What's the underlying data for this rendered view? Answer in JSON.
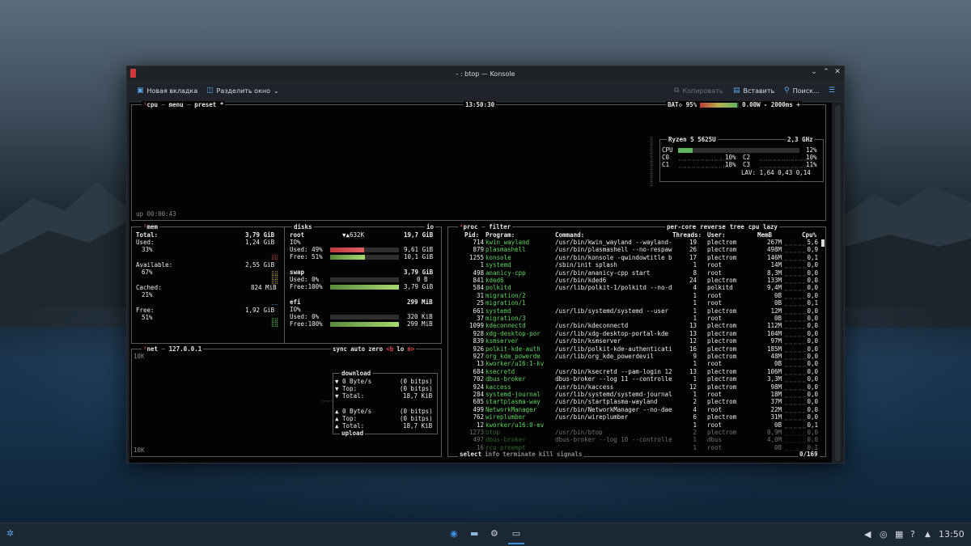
{
  "window": {
    "title": "- : btop — Konsole",
    "controls": [
      "⌄",
      "⌃",
      "✕"
    ]
  },
  "toolbar": {
    "new_tab": "Новая вкладка",
    "split": "Разделить окно",
    "copy": "Копировать",
    "paste": "Вставить",
    "search": "Поиск...",
    "new_tab_icon": "tab-icon",
    "split_icon": "split-view-icon",
    "copy_icon": "copy-icon",
    "paste_icon": "clipboard-icon",
    "search_icon": "search-icon",
    "menu_icon": "hamburger-icon"
  },
  "cpu": {
    "menu_cpu": "cpu",
    "menu_menu": "menu",
    "menu_preset": "preset",
    "menu_star": "*",
    "clock": "13:50:30",
    "battery": "BAT◇ 95%",
    "battery_level": 0.95,
    "power": "0.00W",
    "interval": "- 2000ms +",
    "uptime": "up 00:00:43",
    "model": "Ryzen 5 5625U",
    "freq": "2,3 GHz",
    "cpu_label": "CPU",
    "cpu_total": "12%",
    "cpu_total_level": 0.12,
    "cores": [
      {
        "name": "C0",
        "pct": "10%"
      },
      {
        "name": "C1",
        "pct": "18%"
      },
      {
        "name": "C2",
        "pct": "10%"
      },
      {
        "name": "C3",
        "pct": "11%"
      }
    ],
    "lav": "LAV: 1,64 0,43 0,14"
  },
  "mem": {
    "title": "mem",
    "total_label": "Total:",
    "total": "3,79 GiB",
    "used_label": "Used:",
    "used": "1,24 GiB",
    "used_pct": "33%",
    "avail_label": "Available:",
    "avail": "2,55 GiB",
    "avail_pct": "67%",
    "cached_label": "Cached:",
    "cached": "824 MiB",
    "cached_pct": "21%",
    "free_label": "Free:",
    "free": "1,92 GiB",
    "free_pct": "51%"
  },
  "disks": {
    "title": "disks",
    "io_label": "io",
    "items": [
      {
        "name": "root",
        "io_value": "▼▲632K",
        "size": "19,7 GiB",
        "io": "IO%",
        "used_label": "Used: 49%",
        "used": "9,61 GiB",
        "used_level": 0.49,
        "free_label": "Free: 51%",
        "free": "10,1 GiB",
        "free_level": 0.51
      },
      {
        "name": "swap",
        "size": "3,79 GiB",
        "used_label": "Used:  0%",
        "used": "0 B",
        "used_level": 0,
        "free_label": "Free:100%",
        "free": "3,79 GiB",
        "free_level": 1
      },
      {
        "name": "efi",
        "size": "299 MiB",
        "io": "IO%",
        "used_label": "Used:  0%",
        "used": "320 KiB",
        "used_level": 0,
        "free_label": "Free:100%",
        "free": "299 MiB",
        "free_level": 1
      }
    ]
  },
  "net": {
    "title": "net",
    "iface": "127.0.0.1",
    "opts": [
      "sync",
      "auto",
      "zero",
      "<b",
      "lo",
      "n>"
    ],
    "scale_top": "10K",
    "scale_bottom": "10K",
    "download_title": "download",
    "upload_title": "upload",
    "download": [
      {
        "label": "▼ 0 Byte/s",
        "value": "(0 bitps)"
      },
      {
        "label": "▼ Top:",
        "value": "(0 bitps)"
      },
      {
        "label": "▼ Total:",
        "value": "18,7 KiB"
      }
    ],
    "upload": [
      {
        "label": "▲ 0 Byte/s",
        "value": "(0 bitps)"
      },
      {
        "label": "▲ Top:",
        "value": "(0 bitps)"
      },
      {
        "label": "▲ Total:",
        "value": "18,7 KiB"
      }
    ]
  },
  "proc": {
    "title": "proc",
    "filter": "filter",
    "opts": [
      "per-core",
      "reverse",
      "tree",
      "cpu lazy"
    ],
    "headers": {
      "pid": "Pid:",
      "program": "Program:",
      "command": "Command:",
      "threads": "Threads:",
      "user": "User:",
      "mem": "MemB",
      "cpu": "Cpu%"
    },
    "rows": [
      [
        "714",
        "kwin_wayland",
        "/usr/bin/kwin_wayland --wayland-",
        "19",
        "plectrom",
        "267M",
        "5,6"
      ],
      [
        "879",
        "plasmashell",
        "/usr/bin/plasmashell --no-respaw",
        "26",
        "plectrom",
        "498M",
        "0,9"
      ],
      [
        "1255",
        "konsole",
        "/usr/bin/konsole -qwindowtitle b",
        "17",
        "plectrom",
        "146M",
        "0,1"
      ],
      [
        "1",
        "systemd",
        "/sbin/init splash",
        "1",
        "root",
        "14M",
        "0,0"
      ],
      [
        "498",
        "ananicy-cpp",
        "/usr/bin/ananicy-cpp start",
        "8",
        "root",
        "8,3M",
        "0,0"
      ],
      [
        "841",
        "kded6",
        "/usr/bin/kded6",
        "24",
        "plectrom",
        "133M",
        "0,0"
      ],
      [
        "584",
        "polkitd",
        "/usr/lib/polkit-1/polkitd --no-d",
        "4",
        "polkitd",
        "9,4M",
        "0,0"
      ],
      [
        "31",
        "migration/2",
        "",
        "1",
        "root",
        "0B",
        "0,0"
      ],
      [
        "25",
        "migration/1",
        "",
        "1",
        "root",
        "0B",
        "0,1"
      ],
      [
        "661",
        "systemd",
        "/usr/lib/systemd/systemd --user",
        "1",
        "plectrom",
        "12M",
        "0,0"
      ],
      [
        "37",
        "migration/3",
        "",
        "1",
        "root",
        "0B",
        "0,0"
      ],
      [
        "1099",
        "kdeconnectd",
        "/usr/bin/kdeconnectd",
        "13",
        "plectrom",
        "112M",
        "0,0"
      ],
      [
        "928",
        "xdg-desktop-por",
        "/usr/lib/xdg-desktop-portal-kde",
        "13",
        "plectrom",
        "104M",
        "0,0"
      ],
      [
        "839",
        "ksmserver",
        "/usr/bin/ksmserver",
        "12",
        "plectrom",
        "97M",
        "0,0"
      ],
      [
        "926",
        "polkit-kde-auth",
        "/usr/lib/polkit-kde-authenticati",
        "16",
        "plectrom",
        "185M",
        "0,0"
      ],
      [
        "927",
        "org_kde_powerde",
        "/usr/lib/org_kde_powerdevil",
        "9",
        "plectrom",
        "48M",
        "0,0"
      ],
      [
        "13",
        "kworker/u16:1-kv",
        "",
        "1",
        "root",
        "0B",
        "0,0"
      ],
      [
        "684",
        "ksecretd",
        "/usr/bin/ksecretd --pam-login 12",
        "13",
        "plectrom",
        "106M",
        "0,0"
      ],
      [
        "702",
        "dbus-broker",
        "dbus-broker --log 11 --controlle",
        "1",
        "plectrom",
        "3,3M",
        "0,0"
      ],
      [
        "924",
        "kaccess",
        "/usr/bin/kaccess",
        "12",
        "plectrom",
        "98M",
        "0,0"
      ],
      [
        "284",
        "systemd-journal",
        "/usr/lib/systemd/systemd-journal",
        "1",
        "root",
        "18M",
        "0,0"
      ],
      [
        "685",
        "startplasma-way",
        "/usr/bin/startplasma-wayland",
        "2",
        "plectrom",
        "37M",
        "0,0"
      ],
      [
        "499",
        "NetworkManager",
        "/usr/bin/NetworkManager --no-dae",
        "4",
        "root",
        "22M",
        "0,0"
      ],
      [
        "762",
        "wireplumber",
        "/usr/bin/wireplumber",
        "6",
        "plectrom",
        "31M",
        "0,0"
      ],
      [
        "12",
        "kworker/u16:0-ev",
        "",
        "1",
        "root",
        "0B",
        "0,1"
      ],
      [
        "1273",
        "btop",
        "/usr/bin/btop",
        "2",
        "plectrom",
        "8,9M",
        "0,0"
      ],
      [
        "497",
        "dbus-broker",
        "dbus-broker --log 10 --controlle",
        "1",
        "dbus",
        "4,0M",
        "0,0"
      ],
      [
        "16",
        "rcu_preempt",
        "",
        "1",
        "root",
        "0B",
        "0,1"
      ]
    ],
    "footer_select": "select",
    "footer_actions": [
      "info",
      "terminate",
      "kill",
      "signals"
    ],
    "count": "0/169"
  },
  "taskbar": {
    "launcher_icon": "kde-launcher-icon",
    "apps": [
      "firefox-icon",
      "files-icon",
      "settings-icon",
      "terminal-icon"
    ],
    "tray": [
      "volume-icon",
      "network-icon",
      "clipboard-icon",
      "help-icon",
      "expand-tray-icon"
    ],
    "clock": "13:50"
  }
}
